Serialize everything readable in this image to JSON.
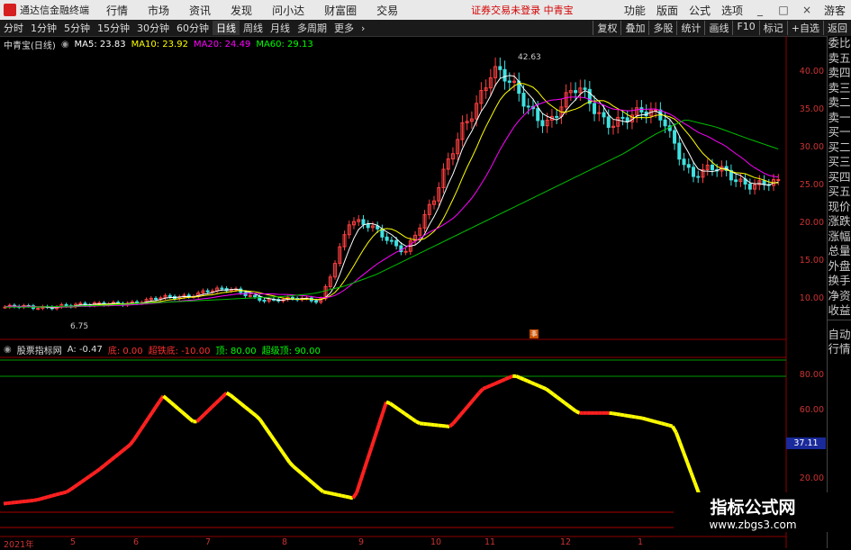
{
  "app": {
    "title": "通达信金融终端"
  },
  "menu": {
    "items": [
      "行情",
      "市场",
      "资讯",
      "发现",
      "问小达",
      "财富圈",
      "交易"
    ],
    "warning": "证券交易未登录 中青宝",
    "right": [
      "功能",
      "版面",
      "公式",
      "选项"
    ],
    "guest": "游客"
  },
  "periods": [
    {
      "label": "分时",
      "active": false
    },
    {
      "label": "1分钟",
      "active": false
    },
    {
      "label": "5分钟",
      "active": false
    },
    {
      "label": "15分钟",
      "active": false
    },
    {
      "label": "30分钟",
      "active": false
    },
    {
      "label": "60分钟",
      "active": false
    },
    {
      "label": "日线",
      "active": true
    },
    {
      "label": "周线",
      "active": false
    },
    {
      "label": "月线",
      "active": false
    },
    {
      "label": "多周期",
      "active": false
    },
    {
      "label": "更多",
      "active": false
    }
  ],
  "toolbar_right": [
    "复权",
    "叠加",
    "多股",
    "统计",
    "画线",
    "F10",
    "标记",
    "+自选",
    "返回"
  ],
  "side_tabs": [
    "委比",
    "卖五",
    "卖四",
    "卖三",
    "卖二",
    "卖一",
    "买一",
    "买二",
    "买三",
    "买四",
    "买五",
    "现价",
    "涨跌",
    "涨幅",
    "总量",
    "外盘",
    "换手",
    "净资",
    "收益"
  ],
  "side_tabs2": [
    "自动",
    "行情"
  ],
  "main_chart": {
    "name": "中青宝(日线)",
    "ma": [
      {
        "label": "MA5: 23.83",
        "color": "#ffffff"
      },
      {
        "label": "MA10: 23.92",
        "color": "#ffff00"
      },
      {
        "label": "MA20: 24.49",
        "color": "#ff00ff"
      },
      {
        "label": "MA60: 29.13",
        "color": "#00ff00"
      }
    ],
    "high_label": "42.63",
    "low_label": "6.75",
    "y_ticks": [
      "40.00",
      "35.00",
      "30.00",
      "25.00",
      "20.00",
      "15.00",
      "10.00"
    ]
  },
  "indicator": {
    "name": "股票指标网",
    "a_label": "A: -0.47",
    "levels": [
      {
        "label": "底: 0.00",
        "color": "#ff3030"
      },
      {
        "label": "超铁底: -10.00",
        "color": "#ff3030"
      },
      {
        "label": "顶: 80.00",
        "color": "#00ff00"
      },
      {
        "label": "超级顶: 90.00",
        "color": "#00ff00"
      }
    ],
    "y_ticks": [
      "80.00",
      "60.00",
      "40.00",
      "20.00"
    ],
    "current": "37.11"
  },
  "x_labels": [
    "2021年",
    "5",
    "6",
    "7",
    "8",
    "9",
    "10",
    "11",
    "12",
    "1"
  ],
  "watermark": {
    "line1": "指标公式网",
    "line2": "www.zbgs3.com"
  },
  "chart_data": {
    "type": "line",
    "title": "中青宝(日线)",
    "series": [
      {
        "name": "MA60",
        "values": [
          8.2,
          8.2,
          8.3,
          8.4,
          8.6,
          8.8,
          9.0,
          9.2,
          9.4,
          9.6,
          10.0,
          11.0,
          12.5,
          14.5,
          16.5,
          18.5,
          20.5,
          22.5,
          24.5,
          26.5,
          28.5,
          31.0,
          33.0,
          32.0,
          30.5,
          29.1
        ]
      },
      {
        "name": "A",
        "values": [
          5,
          7,
          12,
          25,
          40,
          68,
          52,
          70,
          55,
          28,
          12,
          8,
          65,
          52,
          50,
          72,
          80,
          72,
          58,
          58,
          55,
          50,
          0
        ]
      }
    ],
    "ylim": [
      6,
      44
    ]
  }
}
